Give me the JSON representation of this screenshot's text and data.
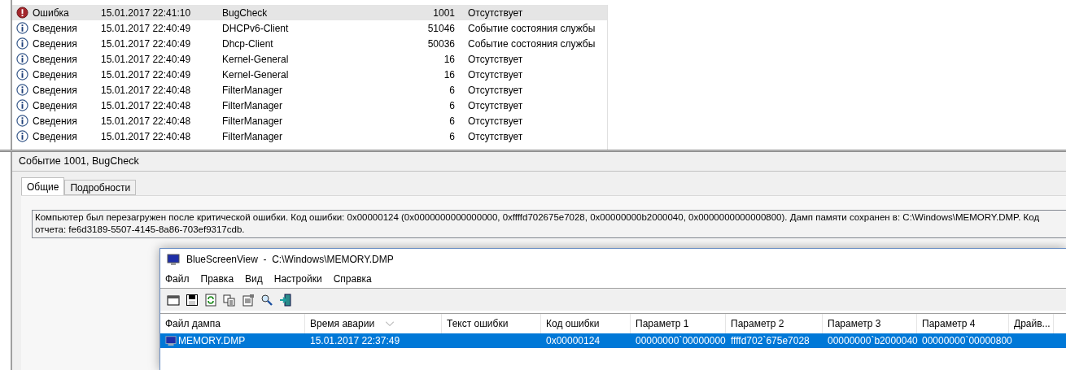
{
  "event_list": {
    "rows": [
      {
        "kind": "error",
        "level": "Ошибка",
        "date": "15.01.2017 22:41:10",
        "source": "BugCheck",
        "id": "1001",
        "category": "Отсутствует",
        "selected": true
      },
      {
        "kind": "info",
        "level": "Сведения",
        "date": "15.01.2017 22:40:49",
        "source": "DHCPv6-Client",
        "id": "51046",
        "category": "Событие состояния службы",
        "selected": false
      },
      {
        "kind": "info",
        "level": "Сведения",
        "date": "15.01.2017 22:40:49",
        "source": "Dhcp-Client",
        "id": "50036",
        "category": "Событие состояния службы",
        "selected": false
      },
      {
        "kind": "info",
        "level": "Сведения",
        "date": "15.01.2017 22:40:49",
        "source": "Kernel-General",
        "id": "16",
        "category": "Отсутствует",
        "selected": false
      },
      {
        "kind": "info",
        "level": "Сведения",
        "date": "15.01.2017 22:40:49",
        "source": "Kernel-General",
        "id": "16",
        "category": "Отсутствует",
        "selected": false
      },
      {
        "kind": "info",
        "level": "Сведения",
        "date": "15.01.2017 22:40:48",
        "source": "FilterManager",
        "id": "6",
        "category": "Отсутствует",
        "selected": false
      },
      {
        "kind": "info",
        "level": "Сведения",
        "date": "15.01.2017 22:40:48",
        "source": "FilterManager",
        "id": "6",
        "category": "Отсутствует",
        "selected": false
      },
      {
        "kind": "info",
        "level": "Сведения",
        "date": "15.01.2017 22:40:48",
        "source": "FilterManager",
        "id": "6",
        "category": "Отсутствует",
        "selected": false
      },
      {
        "kind": "info",
        "level": "Сведения",
        "date": "15.01.2017 22:40:48",
        "source": "FilterManager",
        "id": "6",
        "category": "Отсутствует",
        "selected": false
      }
    ]
  },
  "details": {
    "title": "Событие 1001, BugCheck",
    "tabs": [
      {
        "label": "Общие",
        "selected": true
      },
      {
        "label": "Подробности",
        "selected": false
      }
    ],
    "message": "Компьютер был перезагружен после критической ошибки.  Код ошибки: 0x00000124 (0x0000000000000000, 0xffffd702675e7028, 0x00000000b2000040, 0x0000000000000800). Дамп памяти сохранен в: C:\\Windows\\MEMORY.DMP. Код отчета: fe6d3189-5507-4145-8a86-703ef9317cdb."
  },
  "bluescreenview": {
    "title": "BlueScreenView  -  C:\\Windows\\MEMORY.DMP",
    "menu": [
      "Файл",
      "Правка",
      "Вид",
      "Настройки",
      "Справка"
    ],
    "columns": [
      "Файл дампа",
      "Время аварии",
      "Текст ошибки",
      "Код ошибки",
      "Параметр 1",
      "Параметр 2",
      "Параметр 3",
      "Параметр 4",
      "Драйв..."
    ],
    "rows": [
      {
        "selected": true,
        "cells": [
          "MEMORY.DMP",
          "15.01.2017 22:37:49",
          "",
          "0x00000124",
          "00000000`00000000",
          "ffffd702`675e7028",
          "00000000`b2000040",
          "00000000`00000800",
          ""
        ]
      }
    ]
  }
}
